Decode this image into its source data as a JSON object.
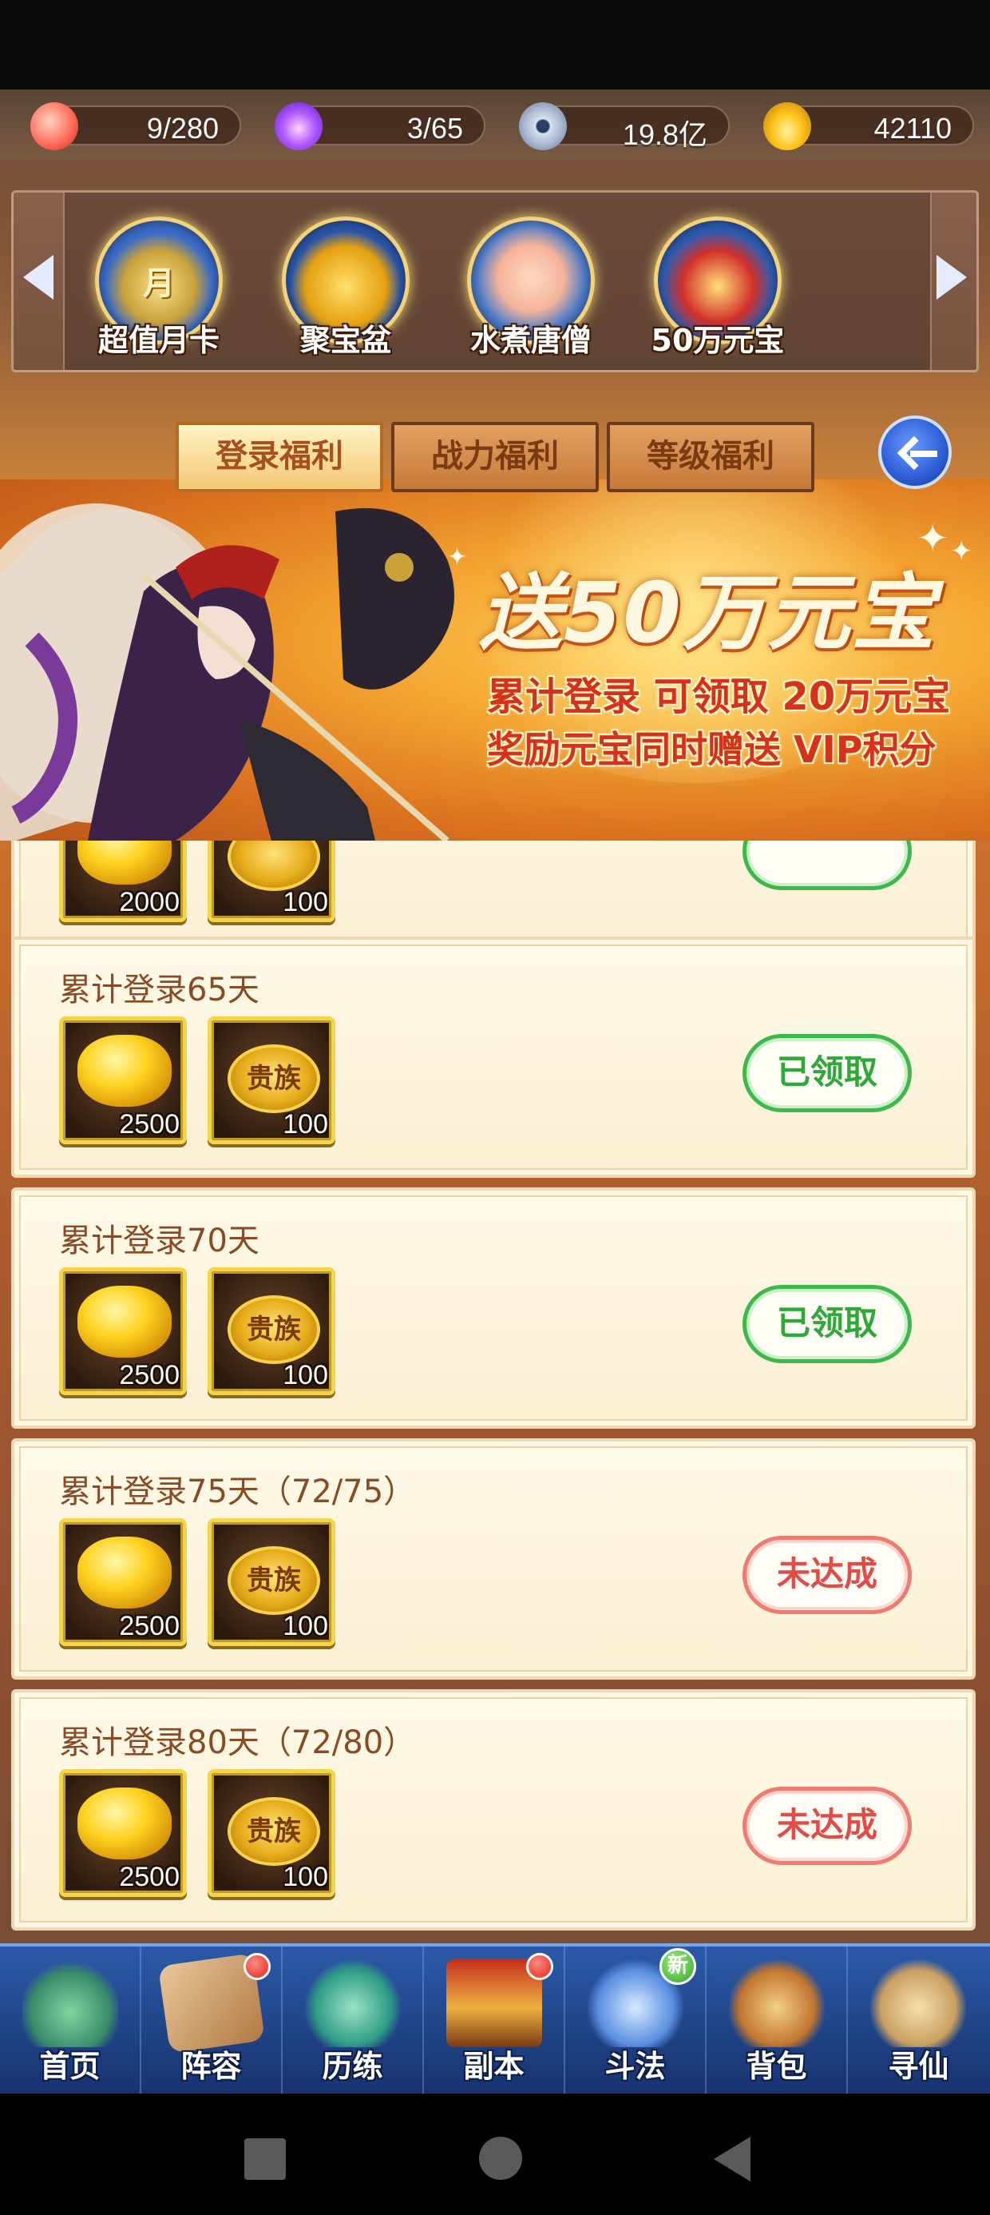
{
  "resources": [
    {
      "icon": "peach-icon",
      "value": "9/280"
    },
    {
      "icon": "spirit-flame-icon",
      "value": "3/65"
    },
    {
      "icon": "copper-coin-icon",
      "value": "19.8亿"
    },
    {
      "icon": "gold-ingot-icon",
      "value": "42110"
    }
  ],
  "promos": [
    {
      "label": "超值月卡",
      "badge": "月"
    },
    {
      "label": "聚宝盆"
    },
    {
      "label": "水煮唐僧"
    },
    {
      "label": "50万元宝"
    }
  ],
  "tabs": [
    {
      "label": "登录福利",
      "active": true
    },
    {
      "label": "战力福利",
      "active": false
    },
    {
      "label": "等级福利",
      "active": false
    }
  ],
  "banner": {
    "title": "送50万元宝",
    "line1": "累计登录 可领取 20万元宝",
    "line2": "奖励元宝同时赠送 VIP积分"
  },
  "rewards": [
    {
      "title": "",
      "items": [
        {
          "type": "gold",
          "qty": "2000"
        },
        {
          "type": "noble",
          "qty": "100"
        }
      ],
      "status": "",
      "status_type": "done"
    },
    {
      "title": "累计登录65天",
      "items": [
        {
          "type": "gold",
          "qty": "2500"
        },
        {
          "type": "noble",
          "label": "贵族",
          "qty": "100"
        }
      ],
      "status": "已领取",
      "status_type": "done"
    },
    {
      "title": "累计登录70天",
      "items": [
        {
          "type": "gold",
          "qty": "2500"
        },
        {
          "type": "noble",
          "label": "贵族",
          "qty": "100"
        }
      ],
      "status": "已领取",
      "status_type": "done"
    },
    {
      "title": "累计登录75天（72/75）",
      "items": [
        {
          "type": "gold",
          "qty": "2500"
        },
        {
          "type": "noble",
          "label": "贵族",
          "qty": "100"
        }
      ],
      "status": "未达成",
      "status_type": "pending"
    },
    {
      "title": "累计登录80天（72/80）",
      "items": [
        {
          "type": "gold",
          "qty": "2500"
        },
        {
          "type": "noble",
          "label": "贵族",
          "qty": "100"
        }
      ],
      "status": "未达成",
      "status_type": "pending"
    }
  ],
  "nav": [
    {
      "label": "首页"
    },
    {
      "label": "阵容",
      "badge": "dot"
    },
    {
      "label": "历练"
    },
    {
      "label": "副本",
      "badge": "dot"
    },
    {
      "label": "斗法",
      "badge": "新"
    },
    {
      "label": "背包"
    },
    {
      "label": "寻仙"
    }
  ],
  "colors": {
    "accent": "#d4321a",
    "done_green": "#2fa83a",
    "pending_red": "#e24c46",
    "nav_blue": "#2c5aa8"
  }
}
